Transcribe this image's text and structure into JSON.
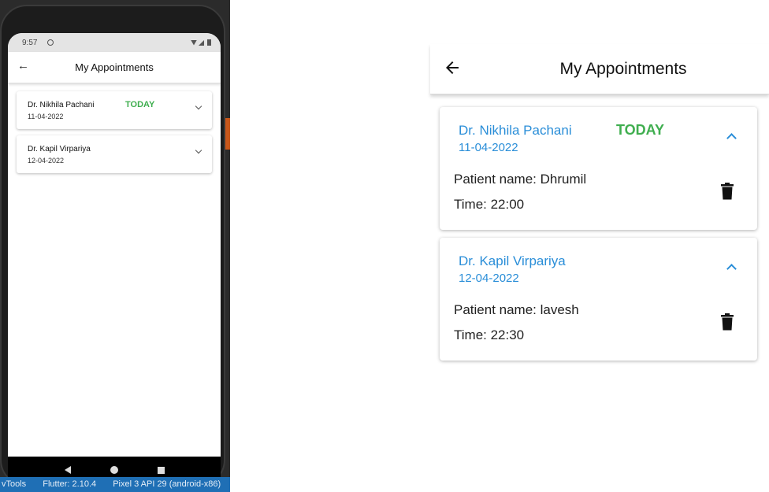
{
  "ide": {
    "status_items": [
      "vTools",
      "Flutter: 2.10.4",
      "Pixel 3 API 29 (android-x86)"
    ]
  },
  "phone": {
    "status_time": "9:57",
    "title": "My Appointments",
    "appointments": [
      {
        "doctor": "Dr. Nikhila Pachani",
        "date": "11-04-2022",
        "badge": "TODAY"
      },
      {
        "doctor": "Dr. Kapil Virpariya",
        "date": "12-04-2022",
        "badge": ""
      }
    ]
  },
  "app": {
    "title": "My Appointments",
    "appointments": [
      {
        "doctor": "Dr. Nikhila Pachani",
        "date": "11-04-2022",
        "badge": "TODAY",
        "patient_label": "Patient name:",
        "patient_name": "Dhrumil",
        "time_label": "Time:",
        "time": "22:00"
      },
      {
        "doctor": "Dr. Kapil Virpariya",
        "date": "12-04-2022",
        "badge": "",
        "patient_label": "Patient name:",
        "patient_name": "lavesh",
        "time_label": "Time:",
        "time": "22:30"
      }
    ]
  },
  "colors": {
    "accent_blue": "#2a8ed8",
    "today_green": "#3fae4f",
    "text_dark": "#222222"
  },
  "icons": [
    "back-arrow-icon",
    "chevron-up-icon",
    "chevron-down-icon",
    "trash-icon"
  ]
}
